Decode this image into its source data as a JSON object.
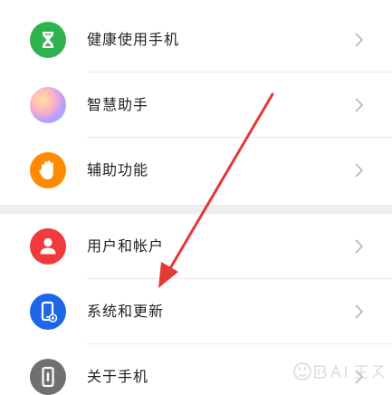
{
  "settings": {
    "group1": [
      {
        "label": "健康使用手机",
        "icon": "hourglass-icon"
      },
      {
        "label": "智慧助手",
        "icon": "assistant-orb-icon"
      },
      {
        "label": "辅助功能",
        "icon": "hand-icon"
      }
    ],
    "group2": [
      {
        "label": "用户和帐户",
        "icon": "user-icon"
      },
      {
        "label": "系统和更新",
        "icon": "phone-update-icon"
      },
      {
        "label": "关于手机",
        "icon": "phone-info-icon"
      }
    ]
  },
  "colors": {
    "health": "#2fb350",
    "access": "#ff8a00",
    "account": "#ef3b3b",
    "system": "#1f66e5",
    "about": "#707070",
    "annotation_arrow": "#e53935"
  },
  "annotation": {
    "type": "arrow",
    "target": "系统和更新"
  }
}
